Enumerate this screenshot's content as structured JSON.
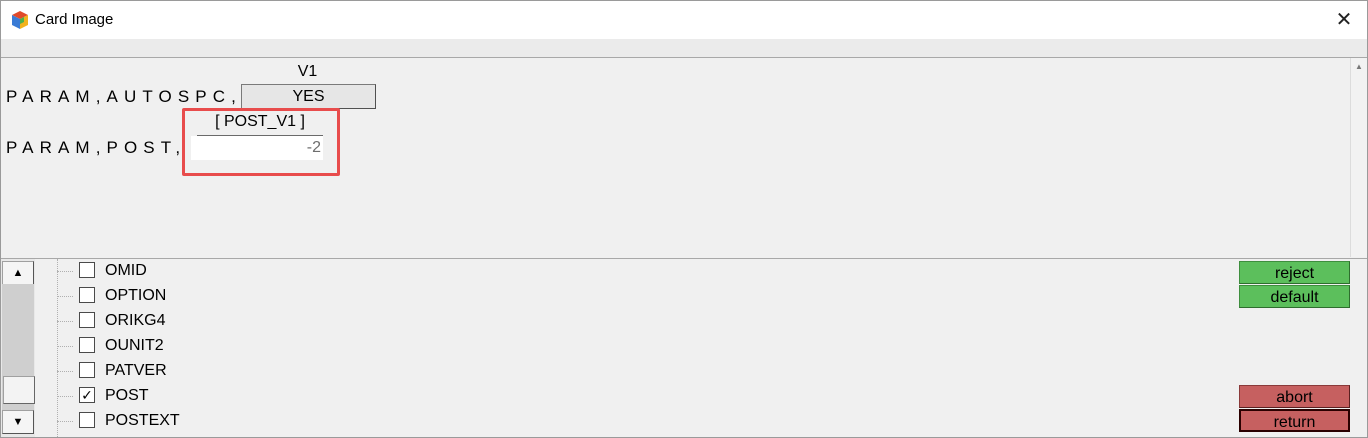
{
  "window": {
    "title": "Card Image",
    "app_icon": "cube-app-icon",
    "close_icon": "close-icon"
  },
  "card": {
    "autospc": {
      "label": "PARAM,AUTOSPC,",
      "header": "V1",
      "value": "YES"
    },
    "post": {
      "label": "PARAM,POST,",
      "header": "[ POST_V1 ]",
      "value": "-2"
    }
  },
  "param_list": {
    "items": [
      {
        "label": "OMID",
        "checked": false
      },
      {
        "label": "OPTION",
        "checked": false
      },
      {
        "label": "ORIKG4",
        "checked": false
      },
      {
        "label": "OUNIT2",
        "checked": false
      },
      {
        "label": "PATVER",
        "checked": false
      },
      {
        "label": "POST",
        "checked": true
      },
      {
        "label": "POSTEXT",
        "checked": false
      }
    ]
  },
  "buttons": {
    "reject": "reject",
    "default": "default",
    "abort": "abort",
    "return": "return"
  },
  "colors": {
    "green": "#5cbf5c",
    "red": "#c66060",
    "highlight": "#e84c4c"
  }
}
